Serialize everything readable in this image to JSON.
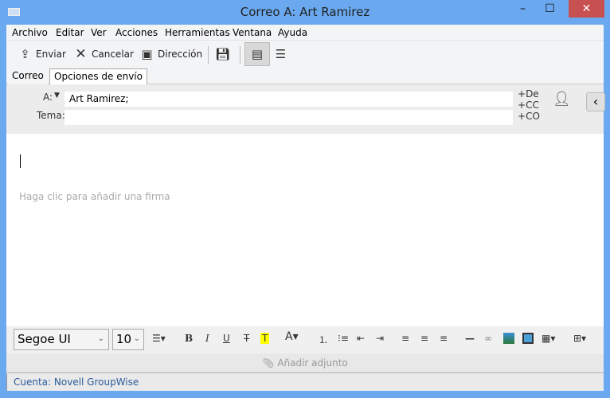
{
  "window": {
    "title": "Correo A: Art Ramirez",
    "minimize": "–",
    "maximize": "☐",
    "close": "✕"
  },
  "menu": [
    "Archivo",
    "Editar",
    "Ver",
    "Acciones",
    "Herramientas",
    "Ventana",
    "Ayuda"
  ],
  "toolbar": {
    "send": "Enviar",
    "cancel": "Cancelar",
    "address": "Dirección"
  },
  "tabs": [
    "Correo",
    "Opciones de envío"
  ],
  "header": {
    "to_label": "A:",
    "to_value": "Art Ramirez;",
    "subject_label": "Tema:",
    "subject_value": "",
    "from": "De",
    "cc": "CC",
    "bc": "CO"
  },
  "body": {
    "signature_placeholder": "Haga clic para añadir una firma"
  },
  "format": {
    "font": "Segoe UI",
    "size": "10"
  },
  "attach": "Añadir adjunto",
  "status": "Cuenta: Novell GroupWise"
}
